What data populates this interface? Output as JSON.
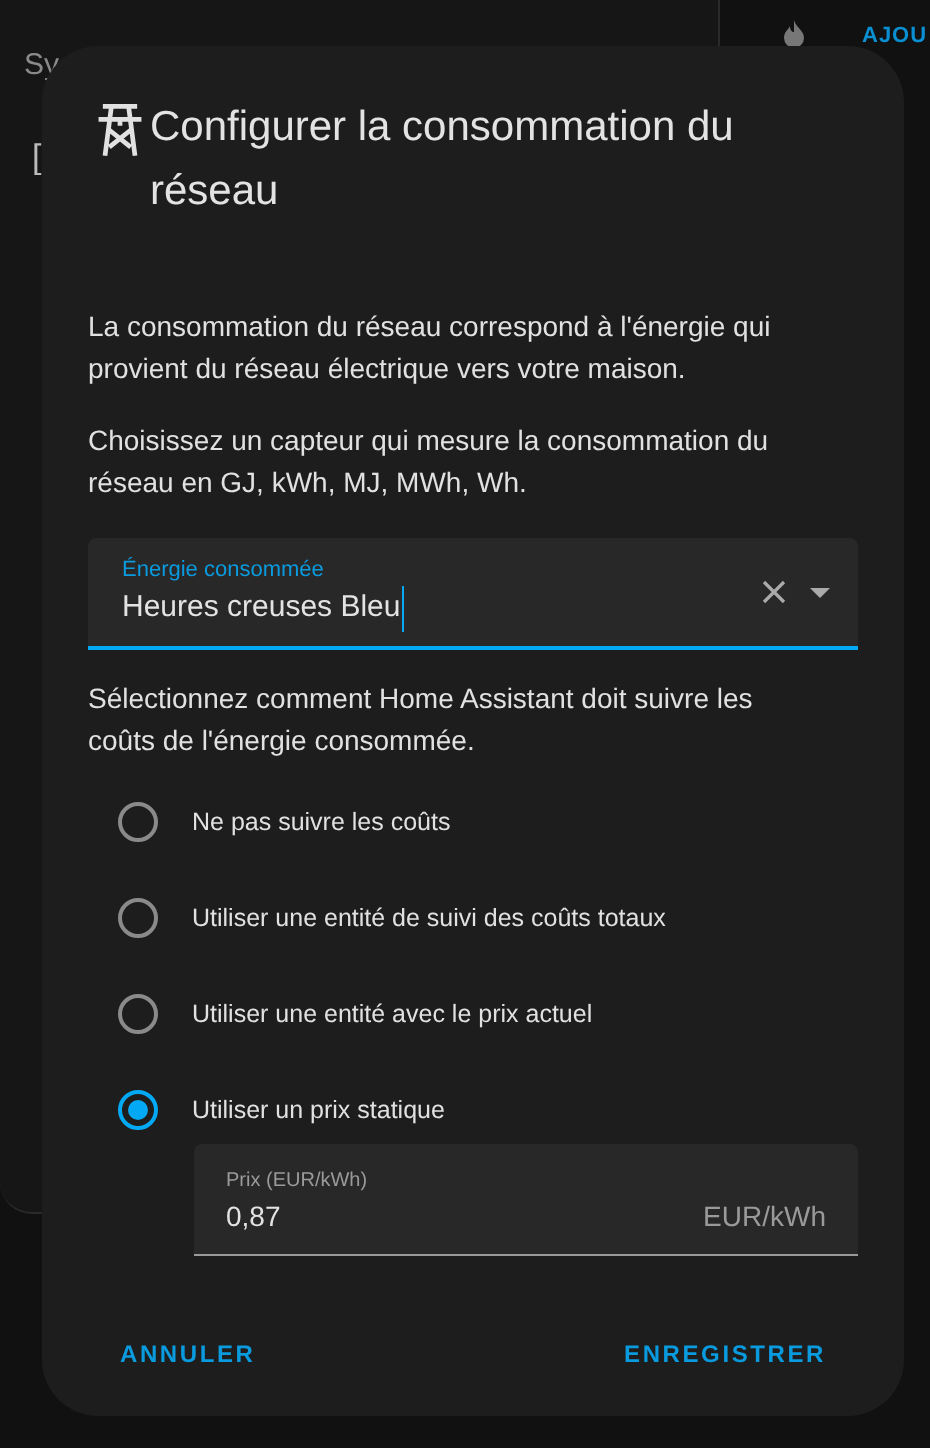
{
  "background": {
    "left_card_heading": "Sy",
    "left_card_text": "[",
    "right_button": "AJOU"
  },
  "dialog": {
    "title": "Configurer la consommation du réseau",
    "paragraphs": [
      "La consommation du réseau correspond à l'énergie qui provient du réseau électrique vers votre maison.",
      "Choisissez un capteur qui mesure la consommation du réseau en GJ, kWh, MJ, MWh, Wh."
    ],
    "sensor_field": {
      "label": "Énergie consommée",
      "value": "Heures creuses Bleu"
    },
    "cost_prompt": "Sélectionnez comment Home Assistant doit suivre les coûts de l'énergie consommée.",
    "options": [
      {
        "label": "Ne pas suivre les coûts",
        "selected": false
      },
      {
        "label": "Utiliser une entité de suivi des coûts totaux",
        "selected": false
      },
      {
        "label": "Utiliser une entité avec le prix actuel",
        "selected": false
      },
      {
        "label": "Utiliser un prix statique",
        "selected": true
      }
    ],
    "price_field": {
      "label": "Prix (EUR/kWh)",
      "value": "0,87",
      "suffix": "EUR/kWh"
    },
    "buttons": [
      "ANNULER",
      "ENREGISTRER"
    ]
  }
}
